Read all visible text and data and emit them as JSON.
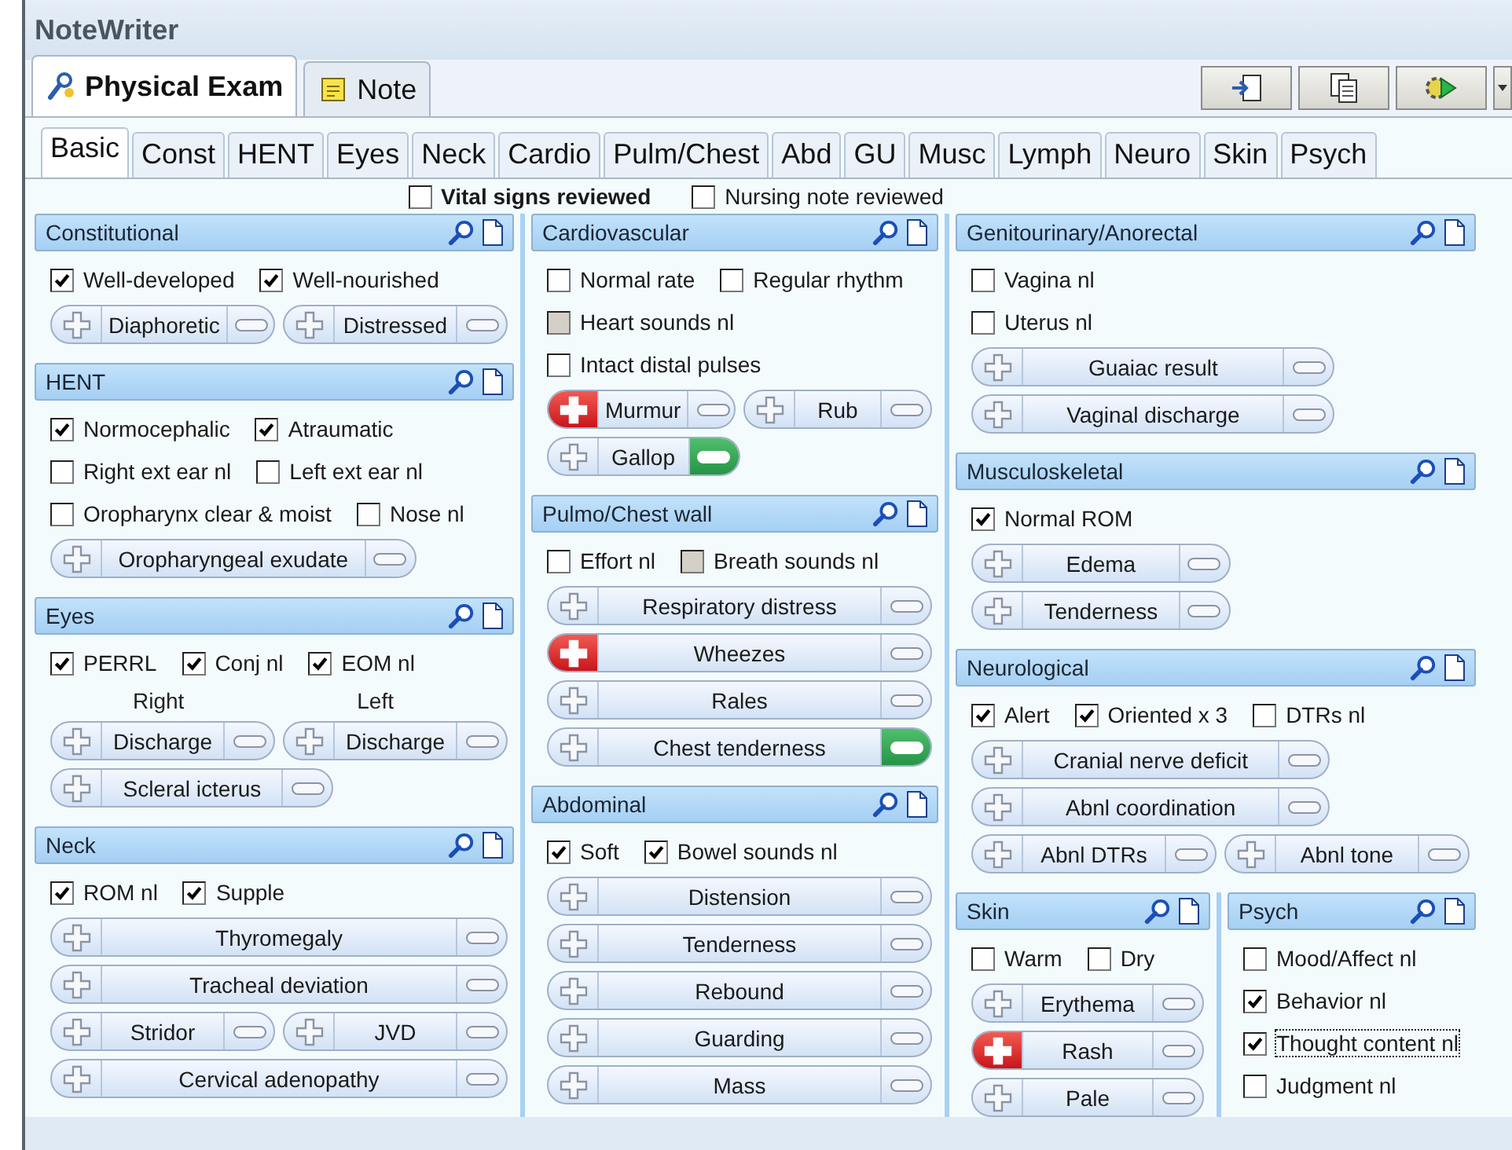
{
  "window": {
    "title": "NoteWriter"
  },
  "main_tabs": [
    {
      "label": "Physical Exam",
      "selected": true
    },
    {
      "label": "Note",
      "selected": false
    }
  ],
  "sub_tabs": [
    {
      "label": "Basic",
      "selected": true
    },
    {
      "label": "Const",
      "selected": false
    },
    {
      "label": "HENT",
      "selected": false
    },
    {
      "label": "Eyes",
      "selected": false
    },
    {
      "label": "Neck",
      "selected": false
    },
    {
      "label": "Cardio",
      "selected": false
    },
    {
      "label": "Pulm/Chest",
      "selected": false
    },
    {
      "label": "Abd",
      "selected": false
    },
    {
      "label": "GU",
      "selected": false
    },
    {
      "label": "Musc",
      "selected": false
    },
    {
      "label": "Lymph",
      "selected": false
    },
    {
      "label": "Neuro",
      "selected": false
    },
    {
      "label": "Skin",
      "selected": false
    },
    {
      "label": "Psych",
      "selected": false
    }
  ],
  "review_checks": [
    {
      "label": "Vital signs reviewed",
      "checked": false
    },
    {
      "label": "Nursing note reviewed",
      "checked": false
    }
  ],
  "columns": [
    {
      "sections": [
        {
          "title": "Constitutional",
          "rows": [
            {
              "items": [
                {
                  "kind": "check",
                  "label": "Well-developed",
                  "checked": true
                },
                {
                  "kind": "check",
                  "label": "Well-nourished",
                  "checked": true
                }
              ]
            },
            {
              "items": [
                {
                  "kind": "toggle",
                  "label": "Diaphoretic",
                  "positive": false,
                  "negative": false
                },
                {
                  "kind": "toggle",
                  "label": "Distressed",
                  "positive": false,
                  "negative": false
                }
              ]
            }
          ]
        },
        {
          "title": "HENT",
          "rows": [
            {
              "items": [
                {
                  "kind": "check",
                  "label": "Normocephalic",
                  "checked": true
                },
                {
                  "kind": "check",
                  "label": "Atraumatic",
                  "checked": true
                }
              ]
            },
            {
              "items": [
                {
                  "kind": "check",
                  "label": "Right ext ear nl",
                  "checked": false
                },
                {
                  "kind": "check",
                  "label": "Left ext ear nl",
                  "checked": false
                }
              ]
            },
            {
              "items": [
                {
                  "kind": "check",
                  "label": "Oropharynx clear & moist",
                  "checked": false
                },
                {
                  "kind": "check",
                  "label": "Nose nl",
                  "checked": false
                }
              ]
            },
            {
              "items": [
                {
                  "kind": "toggle",
                  "label": "Oropharyngeal exudate",
                  "positive": false,
                  "negative": false
                }
              ]
            }
          ]
        },
        {
          "title": "Eyes",
          "rows": [
            {
              "items": [
                {
                  "kind": "check",
                  "label": "PERRL",
                  "checked": true
                },
                {
                  "kind": "check",
                  "label": "Conj nl",
                  "checked": true
                },
                {
                  "kind": "check",
                  "label": "EOM nl",
                  "checked": true
                }
              ]
            },
            {
              "items": [
                {
                  "kind": "caption",
                  "label": "Right"
                },
                {
                  "kind": "caption",
                  "label": "Left"
                }
              ]
            },
            {
              "items": [
                {
                  "kind": "toggle",
                  "label": "Discharge",
                  "positive": false,
                  "negative": false
                },
                {
                  "kind": "toggle",
                  "label": "Discharge",
                  "positive": false,
                  "negative": false
                }
              ]
            },
            {
              "items": [
                {
                  "kind": "toggle",
                  "label": "Scleral icterus",
                  "positive": false,
                  "negative": false
                }
              ]
            }
          ]
        },
        {
          "title": "Neck",
          "rows": [
            {
              "items": [
                {
                  "kind": "check",
                  "label": "ROM nl",
                  "checked": true
                },
                {
                  "kind": "check",
                  "label": "Supple",
                  "checked": true
                }
              ]
            },
            {
              "items": [
                {
                  "kind": "toggle",
                  "label": "Thyromegaly",
                  "positive": false,
                  "negative": false
                }
              ]
            },
            {
              "items": [
                {
                  "kind": "toggle",
                  "label": "Tracheal deviation",
                  "positive": false,
                  "negative": false
                }
              ]
            },
            {
              "items": [
                {
                  "kind": "toggle",
                  "label": "Stridor",
                  "positive": false,
                  "negative": false
                },
                {
                  "kind": "toggle",
                  "label": "JVD",
                  "positive": false,
                  "negative": false
                }
              ]
            },
            {
              "items": [
                {
                  "kind": "toggle",
                  "label": "Cervical adenopathy",
                  "positive": false,
                  "negative": false
                }
              ]
            }
          ]
        }
      ]
    },
    {
      "sections": [
        {
          "title": "Cardiovascular",
          "rows": [
            {
              "items": [
                {
                  "kind": "check",
                  "label": "Normal rate",
                  "checked": false
                },
                {
                  "kind": "check",
                  "label": "Regular rhythm",
                  "checked": false
                }
              ]
            },
            {
              "items": [
                {
                  "kind": "check",
                  "label": "Heart sounds nl",
                  "checked": false,
                  "greyed": true
                }
              ]
            },
            {
              "items": [
                {
                  "kind": "check",
                  "label": "Intact distal pulses",
                  "checked": false
                }
              ]
            },
            {
              "items": [
                {
                  "kind": "toggle",
                  "label": "Murmur",
                  "positive": true,
                  "negative": false
                },
                {
                  "kind": "toggle",
                  "label": "Rub",
                  "positive": false,
                  "negative": false
                }
              ]
            },
            {
              "items": [
                {
                  "kind": "toggle",
                  "label": "Gallop",
                  "positive": false,
                  "negative": true
                }
              ]
            }
          ]
        },
        {
          "title": "Pulmo/Chest wall",
          "rows": [
            {
              "items": [
                {
                  "kind": "check",
                  "label": "Effort nl",
                  "checked": false
                },
                {
                  "kind": "check",
                  "label": "Breath sounds nl",
                  "checked": false,
                  "greyed": true
                }
              ]
            },
            {
              "items": [
                {
                  "kind": "toggle",
                  "label": "Respiratory distress",
                  "positive": false,
                  "negative": false
                }
              ]
            },
            {
              "items": [
                {
                  "kind": "toggle",
                  "label": "Wheezes",
                  "positive": true,
                  "negative": false
                }
              ]
            },
            {
              "items": [
                {
                  "kind": "toggle",
                  "label": "Rales",
                  "positive": false,
                  "negative": false
                }
              ]
            },
            {
              "items": [
                {
                  "kind": "toggle",
                  "label": "Chest tenderness",
                  "positive": false,
                  "negative": true
                }
              ]
            }
          ]
        },
        {
          "title": "Abdominal",
          "rows": [
            {
              "items": [
                {
                  "kind": "check",
                  "label": "Soft",
                  "checked": true
                },
                {
                  "kind": "check",
                  "label": "Bowel sounds nl",
                  "checked": true
                }
              ]
            },
            {
              "items": [
                {
                  "kind": "toggle",
                  "label": "Distension",
                  "positive": false,
                  "negative": false
                }
              ]
            },
            {
              "items": [
                {
                  "kind": "toggle",
                  "label": "Tenderness",
                  "positive": false,
                  "negative": false
                }
              ]
            },
            {
              "items": [
                {
                  "kind": "toggle",
                  "label": "Rebound",
                  "positive": false,
                  "negative": false
                }
              ]
            },
            {
              "items": [
                {
                  "kind": "toggle",
                  "label": "Guarding",
                  "positive": false,
                  "negative": false
                }
              ]
            },
            {
              "items": [
                {
                  "kind": "toggle",
                  "label": "Mass",
                  "positive": false,
                  "negative": false
                }
              ]
            }
          ]
        }
      ]
    },
    {
      "sections": [
        {
          "title": "Genitourinary/Anorectal",
          "rows": [
            {
              "items": [
                {
                  "kind": "check",
                  "label": "Vagina nl",
                  "checked": false
                }
              ]
            },
            {
              "items": [
                {
                  "kind": "check",
                  "label": "Uterus nl",
                  "checked": false
                }
              ]
            },
            {
              "items": [
                {
                  "kind": "toggle",
                  "label": "Guaiac result",
                  "positive": false,
                  "negative": false
                }
              ]
            },
            {
              "items": [
                {
                  "kind": "toggle",
                  "label": "Vaginal discharge",
                  "positive": false,
                  "negative": false
                }
              ]
            }
          ]
        },
        {
          "title": "Musculoskeletal",
          "rows": [
            {
              "items": [
                {
                  "kind": "check",
                  "label": "Normal ROM",
                  "checked": true
                }
              ]
            },
            {
              "items": [
                {
                  "kind": "toggle",
                  "label": "Edema",
                  "positive": false,
                  "negative": false
                }
              ]
            },
            {
              "items": [
                {
                  "kind": "toggle",
                  "label": "Tenderness",
                  "positive": false,
                  "negative": false
                }
              ]
            }
          ]
        },
        {
          "title": "Neurological",
          "rows": [
            {
              "items": [
                {
                  "kind": "check",
                  "label": "Alert",
                  "checked": true
                },
                {
                  "kind": "check",
                  "label": "Oriented x 3",
                  "checked": true
                },
                {
                  "kind": "check",
                  "label": "DTRs nl",
                  "checked": false
                }
              ]
            },
            {
              "items": [
                {
                  "kind": "toggle",
                  "label": "Cranial nerve deficit",
                  "positive": false,
                  "negative": false
                }
              ]
            },
            {
              "items": [
                {
                  "kind": "toggle",
                  "label": "Abnl coordination",
                  "positive": false,
                  "negative": false
                }
              ]
            },
            {
              "items": [
                {
                  "kind": "toggle",
                  "label": "Abnl DTRs",
                  "positive": false,
                  "negative": false
                },
                {
                  "kind": "toggle",
                  "label": "Abnl tone",
                  "positive": false,
                  "negative": false
                }
              ]
            }
          ]
        }
      ],
      "side_by_side": [
        {
          "title": "Skin",
          "rows": [
            {
              "items": [
                {
                  "kind": "check",
                  "label": "Warm",
                  "checked": false
                },
                {
                  "kind": "check",
                  "label": "Dry",
                  "checked": false
                }
              ]
            },
            {
              "items": [
                {
                  "kind": "toggle",
                  "label": "Erythema",
                  "positive": false,
                  "negative": false
                }
              ]
            },
            {
              "items": [
                {
                  "kind": "toggle",
                  "label": "Rash",
                  "positive": true,
                  "negative": false
                }
              ]
            },
            {
              "items": [
                {
                  "kind": "toggle",
                  "label": "Pale",
                  "positive": false,
                  "negative": false
                }
              ]
            }
          ]
        },
        {
          "title": "Psych",
          "rows": [
            {
              "items": [
                {
                  "kind": "check",
                  "label": "Mood/Affect nl",
                  "checked": false
                }
              ]
            },
            {
              "items": [
                {
                  "kind": "check",
                  "label": "Behavior nl",
                  "checked": true
                }
              ]
            },
            {
              "items": [
                {
                  "kind": "check",
                  "label": "Thought content nl",
                  "checked": true,
                  "focused": true
                }
              ]
            },
            {
              "items": [
                {
                  "kind": "check",
                  "label": "Judgment nl",
                  "checked": false
                }
              ]
            }
          ]
        }
      ]
    }
  ]
}
